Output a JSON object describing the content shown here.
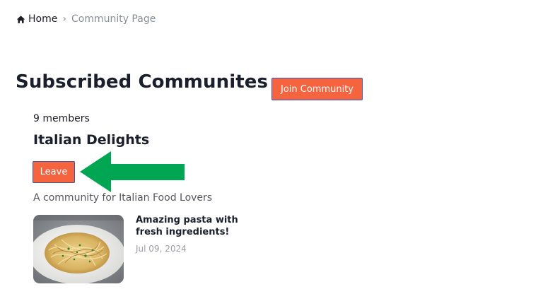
{
  "breadcrumb": {
    "home_label": "Home",
    "separator": "›",
    "current": "Community Page"
  },
  "page": {
    "title": "Subscribed Communites"
  },
  "actions": {
    "join_label": "Join Community"
  },
  "community": {
    "members": "9 members",
    "name": "Italian Delights",
    "leave_label": "Leave",
    "description": "A community for Italian Food Lovers"
  },
  "post": {
    "title": "Amazing pasta with fresh ingredients!",
    "date": "Jul 09, 2024"
  },
  "colors": {
    "accent": "#f5643f",
    "button_border": "#3d5ba8",
    "annotation_arrow": "#00a651",
    "muted_text": "#8a8f98"
  },
  "icons": [
    "home-icon",
    "chevron-right-icon",
    "pasta-image",
    "annotation-arrow"
  ]
}
